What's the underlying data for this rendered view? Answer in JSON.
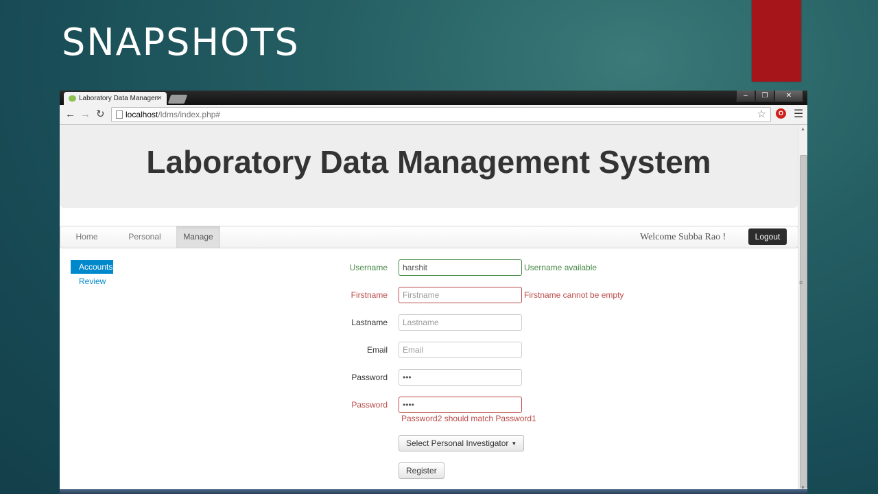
{
  "slide": {
    "title": "SNAPSHOTS"
  },
  "browser": {
    "tab_title": "Laboratory Data Managen",
    "tab_close": "×",
    "url_host": "localhost",
    "url_path": "/ldms/index.php#",
    "window_buttons": [
      "–",
      "❐",
      "✕"
    ]
  },
  "site": {
    "title": "Laboratory Data Management System"
  },
  "navbar": {
    "items": [
      {
        "label": "Home",
        "active": false
      },
      {
        "label": "Personal",
        "active": false
      },
      {
        "label": "Manage",
        "active": true
      }
    ],
    "welcome": "Welcome Subba Rao !",
    "logout": "Logout"
  },
  "sidebar": {
    "items": [
      {
        "label": "Accounts",
        "active": true
      },
      {
        "label": "Review",
        "active": false
      }
    ]
  },
  "form": {
    "username": {
      "label": "Username",
      "value": "harshit",
      "help": "Username available"
    },
    "firstname": {
      "label": "Firstname",
      "placeholder": "Firstname",
      "help": "Firstname cannot be empty"
    },
    "lastname": {
      "label": "Lastname",
      "placeholder": "Lastname"
    },
    "email": {
      "label": "Email",
      "placeholder": "Email"
    },
    "password1": {
      "label": "Password",
      "value": "•••"
    },
    "password2": {
      "label": "Password",
      "value": "••••",
      "help": "Password2 should match Password1"
    },
    "investigator_button": "Select Personal Investigator",
    "register_button": "Register"
  },
  "colors": {
    "accent_bar": "#a51519",
    "success": "#468847",
    "error": "#b94a48",
    "link": "#0088cc"
  }
}
